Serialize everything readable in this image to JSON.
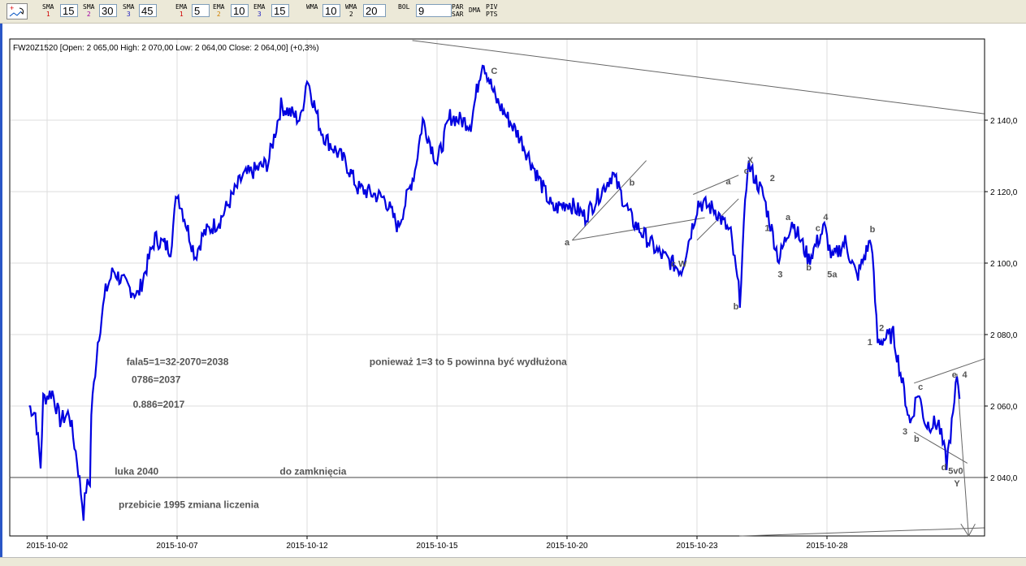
{
  "toolbar": {
    "indicators": [
      {
        "name": "SMA",
        "sub": "1",
        "subcolor": "#d00000",
        "value": "15"
      },
      {
        "name": "SMA",
        "sub": "2",
        "subcolor": "#a000a0",
        "value": "30"
      },
      {
        "name": "SMA",
        "sub": "3",
        "subcolor": "#2020c0",
        "value": "45"
      },
      {
        "name": "EMA",
        "sub": "1",
        "subcolor": "#d00000",
        "value": "5"
      },
      {
        "name": "EMA",
        "sub": "2",
        "subcolor": "#d08000",
        "value": "10"
      },
      {
        "name": "EMA",
        "sub": "3",
        "subcolor": "#2020c0",
        "value": "15"
      },
      {
        "name": "WMA",
        "sub": "",
        "subcolor": "#000",
        "value": "10"
      },
      {
        "name": "WMA",
        "sub": "2",
        "subcolor": "#000",
        "value": "20"
      },
      {
        "name": "BOL",
        "sub": "",
        "subcolor": "#000",
        "value": "9"
      }
    ],
    "buttons": [
      {
        "l1": "PAR",
        "l2": "SAR"
      },
      {
        "l1": "DMA",
        "l2": ""
      },
      {
        "l1": "PIV",
        "l2": "PTS"
      }
    ]
  },
  "chart_data": {
    "type": "line",
    "title": "FW20Z1520 [Open: 2 065,00  High: 2 070,00  Low: 2 064,00  Close: 2 064,00] (+0,3%)",
    "series_color": "#0000e0",
    "x_ticks": [
      "2015-10-02",
      "2015-10-07",
      "2015-10-12",
      "2015-10-15",
      "2015-10-20",
      "2015-10-23",
      "2015-10-28"
    ],
    "y_ticks": [
      "2 040,0",
      "2 060,0",
      "2 080,0",
      "2 100,0",
      "2 120,0",
      "2 140,0"
    ],
    "y_tick_values": [
      2040,
      2060,
      2080,
      2100,
      2120,
      2140
    ],
    "ylim": [
      2024,
      2163
    ],
    "xlim": [
      -0.29,
      7.21
    ],
    "grid": true,
    "series": [
      {
        "name": "FW20Z1520",
        "points": [
          [
            -0.14,
            2060
          ],
          [
            -0.09,
            2058
          ],
          [
            -0.05,
            2043
          ],
          [
            -0.03,
            2062
          ],
          [
            0.04,
            2064
          ],
          [
            0.1,
            2056
          ],
          [
            0.17,
            2058
          ],
          [
            0.23,
            2045
          ],
          [
            0.28,
            2030
          ],
          [
            0.3,
            2037
          ],
          [
            0.33,
            2039
          ],
          [
            0.34,
            2058
          ],
          [
            0.39,
            2078
          ],
          [
            0.45,
            2092
          ],
          [
            0.51,
            2098
          ],
          [
            0.6,
            2094
          ],
          [
            0.7,
            2091
          ],
          [
            0.83,
            2107
          ],
          [
            0.95,
            2104
          ],
          [
            1.0,
            2120
          ],
          [
            1.14,
            2102
          ],
          [
            1.2,
            2108
          ],
          [
            1.33,
            2112
          ],
          [
            1.5,
            2124
          ],
          [
            1.7,
            2128
          ],
          [
            1.8,
            2144
          ],
          [
            1.95,
            2140
          ],
          [
            2.0,
            2152
          ],
          [
            2.1,
            2138
          ],
          [
            2.14,
            2135
          ],
          [
            2.3,
            2128
          ],
          [
            2.39,
            2121
          ],
          [
            2.6,
            2118
          ],
          [
            2.7,
            2110
          ],
          [
            2.83,
            2126
          ],
          [
            2.89,
            2140
          ],
          [
            3.0,
            2128
          ],
          [
            3.1,
            2141
          ],
          [
            3.26,
            2139
          ],
          [
            3.35,
            2157
          ],
          [
            3.45,
            2146
          ],
          [
            3.64,
            2135
          ],
          [
            3.89,
            2115
          ],
          [
            4.01,
            2117
          ],
          [
            4.14,
            2113
          ],
          [
            4.35,
            2125
          ],
          [
            4.5,
            2112
          ],
          [
            4.7,
            2103
          ],
          [
            4.88,
            2098
          ],
          [
            5.01,
            2117
          ],
          [
            5.14,
            2115
          ],
          [
            5.26,
            2108
          ],
          [
            5.33,
            2090
          ],
          [
            5.39,
            2128
          ],
          [
            5.51,
            2119
          ],
          [
            5.63,
            2101
          ],
          [
            5.73,
            2112
          ],
          [
            5.86,
            2101
          ],
          [
            5.98,
            2110
          ],
          [
            6.04,
            2101
          ],
          [
            6.14,
            2106
          ],
          [
            6.23,
            2096
          ],
          [
            6.34,
            2107
          ],
          [
            6.39,
            2078
          ],
          [
            6.51,
            2080
          ],
          [
            6.64,
            2055
          ],
          [
            6.7,
            2064
          ],
          [
            6.76,
            2055
          ],
          [
            6.86,
            2055
          ],
          [
            6.92,
            2044
          ],
          [
            6.98,
            2060
          ],
          [
            7.0,
            2069
          ],
          [
            7.02,
            2062
          ]
        ]
      }
    ],
    "lines": [
      [
        [
          2.81,
          2162.3
        ],
        [
          7.21,
          2141.8
        ]
      ],
      [
        [
          -0.29,
          2040
        ],
        [
          7.21,
          2040
        ]
      ],
      [
        [
          5.325,
          2023.6
        ],
        [
          7.21,
          2025.9
        ]
      ],
      [
        [
          4.04,
          2106.4
        ],
        [
          4.61,
          2128.7
        ]
      ],
      [
        [
          4.04,
          2106.4
        ],
        [
          5.06,
          2112.7
        ]
      ],
      [
        [
          4.97,
          2119.2
        ],
        [
          5.32,
          2124.6
        ]
      ],
      [
        [
          5.0,
          2106.4
        ],
        [
          5.32,
          2118
        ]
      ],
      [
        [
          6.67,
          2066.4
        ],
        [
          7.21,
          2073.2
        ]
      ],
      [
        [
          6.67,
          2052.7
        ],
        [
          7.08,
          2044
        ]
      ],
      [
        [
          7.0,
          2069
        ],
        [
          7.09,
          2023.6
        ]
      ],
      [
        [
          7.03,
          2027
        ],
        [
          7.09,
          2023.6
        ]
      ],
      [
        [
          7.14,
          2027
        ],
        [
          7.09,
          2023.6
        ]
      ]
    ],
    "wave_labels": [
      {
        "t": "C",
        "x": 3.44,
        "v": 2153
      },
      {
        "t": "a",
        "x": 4.0,
        "v": 2105
      },
      {
        "t": "b",
        "x": 4.5,
        "v": 2121.7
      },
      {
        "t": "c W",
        "x": 4.86,
        "v": 2099
      },
      {
        "t": "a",
        "x": 5.24,
        "v": 2122
      },
      {
        "t": "c",
        "x": 5.38,
        "v": 2125
      },
      {
        "t": "X",
        "x": 5.41,
        "v": 2128
      },
      {
        "t": "2",
        "x": 5.58,
        "v": 2123
      },
      {
        "t": "1",
        "x": 5.54,
        "v": 2109
      },
      {
        "t": "b",
        "x": 5.3,
        "v": 2087
      },
      {
        "t": "a",
        "x": 5.7,
        "v": 2112
      },
      {
        "t": "3",
        "x": 5.64,
        "v": 2096
      },
      {
        "t": "b",
        "x": 5.86,
        "v": 2098
      },
      {
        "t": "c",
        "x": 5.93,
        "v": 2109
      },
      {
        "t": "4",
        "x": 5.99,
        "v": 2112
      },
      {
        "t": "5a",
        "x": 6.04,
        "v": 2096
      },
      {
        "t": "b",
        "x": 6.35,
        "v": 2108.6
      },
      {
        "t": "2",
        "x": 6.42,
        "v": 2081
      },
      {
        "t": "1",
        "x": 6.33,
        "v": 2077
      },
      {
        "t": "c",
        "x": 6.72,
        "v": 2064.5
      },
      {
        "t": "3",
        "x": 6.6,
        "v": 2052
      },
      {
        "t": "b",
        "x": 6.69,
        "v": 2050
      },
      {
        "t": "d",
        "x": 6.9,
        "v": 2042
      },
      {
        "t": "e",
        "x": 6.98,
        "v": 2068
      },
      {
        "t": "4",
        "x": 7.06,
        "v": 2068
      },
      {
        "t": "5v0",
        "x": 6.99,
        "v": 2041
      },
      {
        "t": "Y",
        "x": 7.0,
        "v": 2037.5
      }
    ],
    "annotations": [
      {
        "t": "fala5=1=32-2070=2038",
        "x": 0.61,
        "v": 2071.5
      },
      {
        "t": "ponieważ 1=3 to 5 powinna być wydłużona",
        "x": 2.48,
        "v": 2071.5
      },
      {
        "t": "0786=2037",
        "x": 0.65,
        "v": 2066.5
      },
      {
        "t": "0.886=2017",
        "x": 0.66,
        "v": 2059.5
      },
      {
        "t": "luka 2040",
        "x": 0.52,
        "v": 2040.8
      },
      {
        "t": "do zamknięcia",
        "x": 1.79,
        "v": 2040.8
      },
      {
        "t": "przebicie 1995 zmiana liczenia",
        "x": 0.55,
        "v": 2031.5
      }
    ]
  }
}
